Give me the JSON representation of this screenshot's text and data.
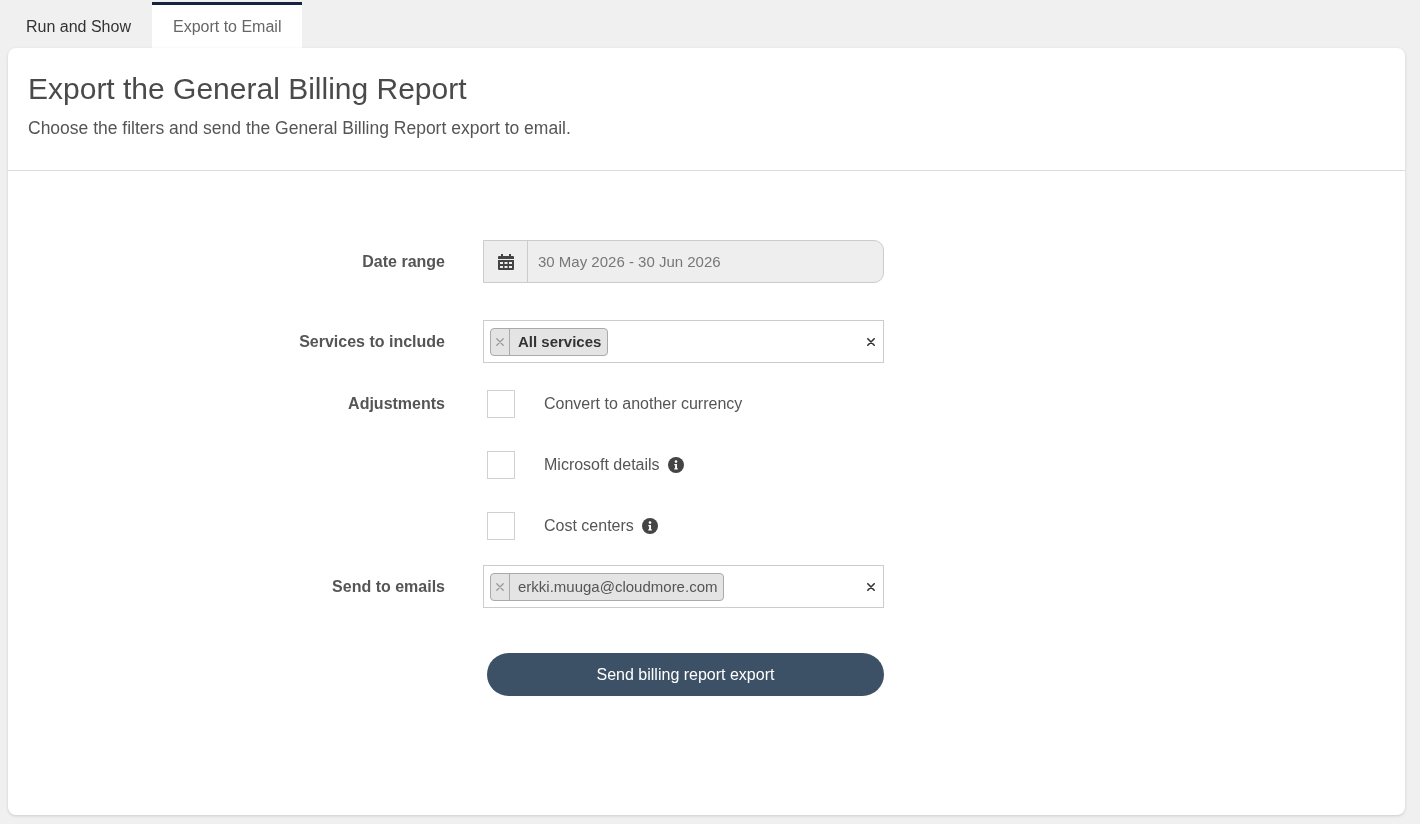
{
  "tabs": [
    {
      "label": "Run and Show",
      "selected": false
    },
    {
      "label": "Export to Email",
      "selected": true
    }
  ],
  "header": {
    "title": "Export the General Billing Report",
    "subtitle": "Choose the filters and send the General Billing Report export to email."
  },
  "form": {
    "fields": [
      {
        "kind": "date",
        "label": "Date range",
        "value": "30 May 2026 - 30 Jun 2026",
        "disabled": true
      },
      {
        "kind": "select",
        "label": "Services to include",
        "tags": [
          "All services"
        ]
      },
      {
        "kind": "checkboxes",
        "label": "Adjustments",
        "options": [
          {
            "label": "Convert to another currency",
            "checked": false,
            "info": false
          },
          {
            "label": "Microsoft details",
            "checked": false,
            "info": true
          },
          {
            "label": "Cost centers",
            "checked": false,
            "info": true
          }
        ]
      },
      {
        "kind": "emails",
        "label": "Send to emails",
        "tags": [
          "erkki.muuga@cloudmore.com"
        ]
      }
    ],
    "submit": {
      "label": "Send billing report export"
    }
  }
}
